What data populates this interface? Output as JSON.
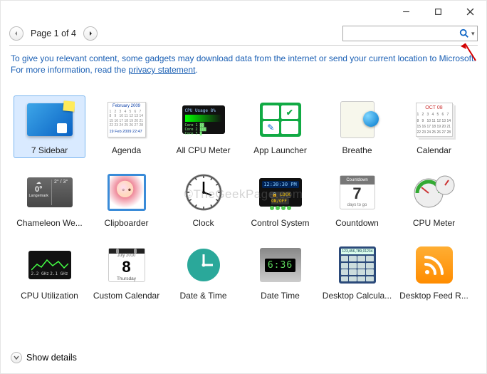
{
  "titlebar": {
    "minimize": "–",
    "maximize": "☐",
    "close": "✕"
  },
  "toolbar": {
    "page_label": "Page 1 of 4",
    "search_placeholder": ""
  },
  "notice": {
    "text_a": "To give you relevant content, some gadgets may download data from the internet or send your current location to Microsoft. For more information, read the ",
    "link": "privacy statement",
    "text_b": "."
  },
  "gadgets": [
    {
      "label": "7 Sidebar",
      "selected": true,
      "kind": "sidebar"
    },
    {
      "label": "Agenda",
      "selected": false,
      "kind": "agenda"
    },
    {
      "label": "All CPU Meter",
      "selected": false,
      "kind": "allcpu"
    },
    {
      "label": "App Launcher",
      "selected": false,
      "kind": "launcher"
    },
    {
      "label": "Breathe",
      "selected": false,
      "kind": "breathe"
    },
    {
      "label": "Calendar",
      "selected": false,
      "kind": "calendar"
    },
    {
      "label": "Chameleon We...",
      "selected": false,
      "kind": "weather"
    },
    {
      "label": "Clipboarder",
      "selected": false,
      "kind": "clip"
    },
    {
      "label": "Clock",
      "selected": false,
      "kind": "clock"
    },
    {
      "label": "Control System",
      "selected": false,
      "kind": "control"
    },
    {
      "label": "Countdown",
      "selected": false,
      "kind": "countdown"
    },
    {
      "label": "CPU Meter",
      "selected": false,
      "kind": "cpumeter"
    },
    {
      "label": "CPU Utilization",
      "selected": false,
      "kind": "cpuutil"
    },
    {
      "label": "Custom Calendar",
      "selected": false,
      "kind": "customcal"
    },
    {
      "label": "Date & Time",
      "selected": false,
      "kind": "datetime"
    },
    {
      "label": "Date Time",
      "selected": false,
      "kind": "datetime2"
    },
    {
      "label": "Desktop Calcula...",
      "selected": false,
      "kind": "calc"
    },
    {
      "label": "Desktop Feed R...",
      "selected": false,
      "kind": "rss"
    }
  ],
  "thumb_text": {
    "agenda_month": "February 2009",
    "allcpu_title": "CPU Usage  8%",
    "countdown_top": "Countdown",
    "countdown_num": "7",
    "countdown_sub": "days to go",
    "customcal_month": "July 2010",
    "customcal_day": "8",
    "customcal_wd": "Thursday",
    "datetime2_clock": "6:36",
    "control_time": "12:30:30 PM",
    "control_lock": "LOCK ON/OFF",
    "calc_digits": "123,456,789,01234",
    "calendar_month": "OCT 08",
    "weather_temp": "0°",
    "weather_hi": "2° / 3°",
    "weather_place": "Langemark",
    "agenda_footer": "19 Feb 2009 22:47",
    "cpuutil_left": "2.2 GHz",
    "cpuutil_right": "2.1 GHz"
  },
  "footer": {
    "show_details": "Show details"
  },
  "watermark": "©TheGeekPage.com"
}
